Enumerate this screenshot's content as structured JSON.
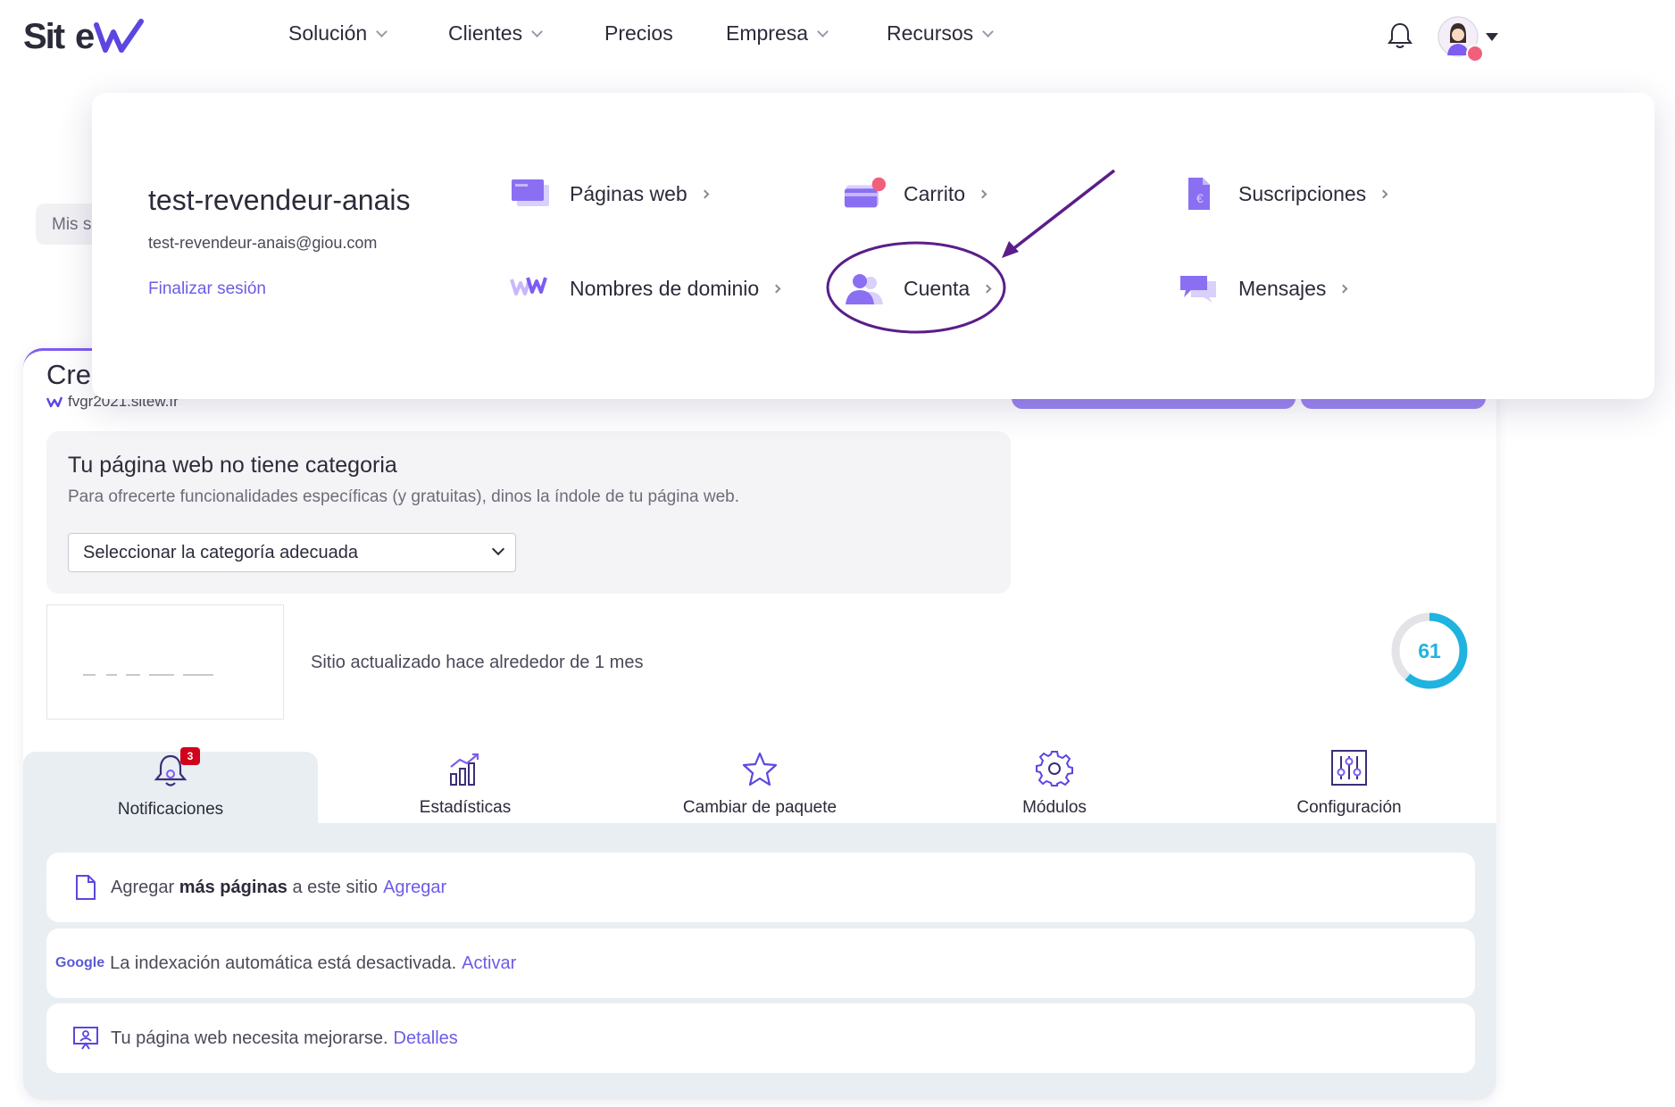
{
  "brand": {
    "logo_text": "Sitew",
    "accent": "#6c5ce7",
    "purple_dark": "#5a1e8a"
  },
  "nav": {
    "items": [
      {
        "label": "Solución",
        "has_chevron": true
      },
      {
        "label": "Clientes",
        "has_chevron": true
      },
      {
        "label": "Precios",
        "has_chevron": false
      },
      {
        "label": "Empresa",
        "has_chevron": true
      },
      {
        "label": "Recursos",
        "has_chevron": true
      }
    ],
    "bell_icon": "bell-icon",
    "avatar_icon": "user-avatar"
  },
  "background": {
    "mis_sitios_pill": "Mis s",
    "card_title": "Cre",
    "site_url": "fvgr2021.sitew.fr",
    "category": {
      "title": "Tu página web no tiene categoria",
      "description": "Para ofrecerte funcionalidades específicas (y gratuitas), dinos la índole de tu página web.",
      "select_value": "Seleccionar la categoría adecuada"
    },
    "updated_text": "Sitio actualizado hace alrededor de 1 mes",
    "score": "61",
    "score_fraction": 0.61
  },
  "tabs": [
    {
      "label": "Notificaciones",
      "icon": "bell-icon",
      "badge": "3",
      "active": true
    },
    {
      "label": "Estadísticas",
      "icon": "chart-icon",
      "active": false
    },
    {
      "label": "Cambiar de paquete",
      "icon": "star-icon",
      "active": false
    },
    {
      "label": "Módulos",
      "icon": "gear-icon",
      "active": false
    },
    {
      "label": "Configuración",
      "icon": "sliders-icon",
      "active": false
    }
  ],
  "notifications": [
    {
      "icon": "page-icon",
      "pre": "Agregar ",
      "bold": "más páginas",
      "post": " a este sitio",
      "link": "Agregar"
    },
    {
      "icon": "google-icon",
      "icon_text": "Google",
      "pre": "La indexación automática está desactivada.",
      "link": "Activar"
    },
    {
      "icon": "monitor-icon",
      "pre": "Tu página web necesita mejorarse.",
      "link": "Detalles"
    }
  ],
  "dropdown": {
    "username": "test-revendeur-anais",
    "email": "test-revendeur-anais@giou.com",
    "logout": "Finalizar sesión",
    "items": [
      {
        "label": "Páginas web",
        "icon": "pages-icon"
      },
      {
        "label": "Carrito",
        "icon": "cart-card-icon"
      },
      {
        "label": "Suscripciones",
        "icon": "subscription-doc-icon"
      },
      {
        "label": "Nombres de dominio",
        "icon": "domain-www-icon"
      },
      {
        "label": "Cuenta",
        "icon": "account-user-icon"
      },
      {
        "label": "Mensajes",
        "icon": "messages-icon"
      }
    ]
  }
}
